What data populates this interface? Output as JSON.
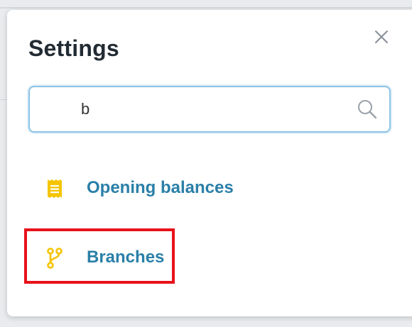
{
  "dialog": {
    "title": "Settings",
    "close_icon": "close-icon"
  },
  "search": {
    "value": "b",
    "icon": "search-icon"
  },
  "results": [
    {
      "label": "Opening balances",
      "icon": "receipt-icon"
    },
    {
      "label": "Branches",
      "icon": "branch-icon"
    }
  ],
  "colors": {
    "accent": "#2a7fa8",
    "icon": "#f5c400",
    "highlight": "#e8121a",
    "focus_border": "#8dc3e6"
  }
}
